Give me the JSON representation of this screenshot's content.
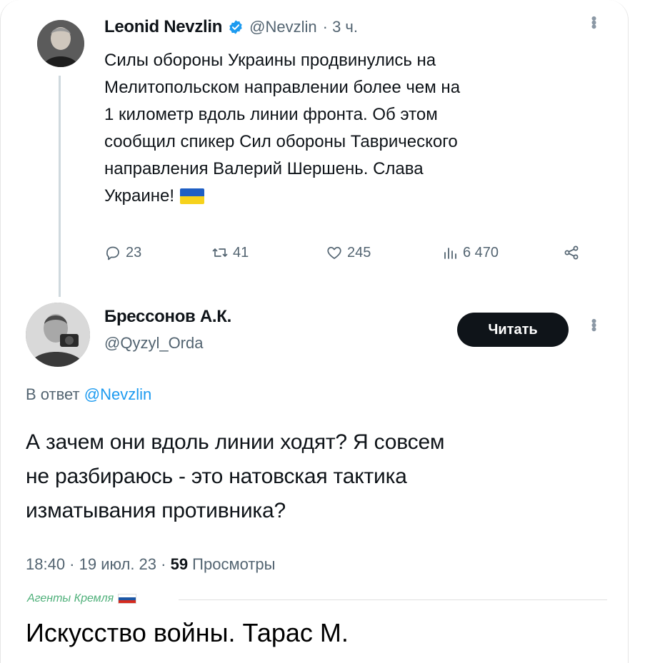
{
  "original_tweet": {
    "author_name": "Leonid Nevzlin",
    "author_handle": "@Nevzlin",
    "time": "· 3 ч.",
    "text_lines": [
      "Силы обороны Украины продвинулись на",
      "Мелитопольском направлении более чем на",
      "1 километр вдоль линии фронта. Об этом",
      "сообщил спикер Сил обороны Таврического",
      "направления Валерий Шершень. Слава",
      "Украине!"
    ],
    "flag_colors": [
      "#1f5fc4",
      "#f6d21c"
    ],
    "actions": {
      "replies": "23",
      "retweets": "41",
      "likes": "245",
      "views": "6 470"
    },
    "icons": [
      "verified-badge-icon",
      "reply-icon",
      "retweet-icon",
      "like-icon",
      "views-icon",
      "share-icon",
      "more-icon"
    ]
  },
  "reply_tweet": {
    "author_name": "Брессонов А.К.",
    "author_handle": "@Qyzyl_Orda",
    "follow_label": "Читать",
    "reply_prefix": "В ответ",
    "reply_handle": "@Nevzlin",
    "text_lines": [
      "А зачем они вдоль линии ходят? Я совсем",
      "не разбираюсь - это натовская тактика",
      "изматывания противника?"
    ],
    "timestamp": "18:40 · 19 июл. 23 · ",
    "views_count": "59",
    "views_label": " Просмотры"
  },
  "watermark": {
    "text": "Агенты Кремля",
    "flag_colors": [
      "#ffffff",
      "#1c57a5",
      "#d52b1e"
    ]
  },
  "caption": "Искусство войны. Тарас М.",
  "colors": {
    "accent": "#1d9bf0",
    "muted": "#536471",
    "text": "#0f1419"
  }
}
